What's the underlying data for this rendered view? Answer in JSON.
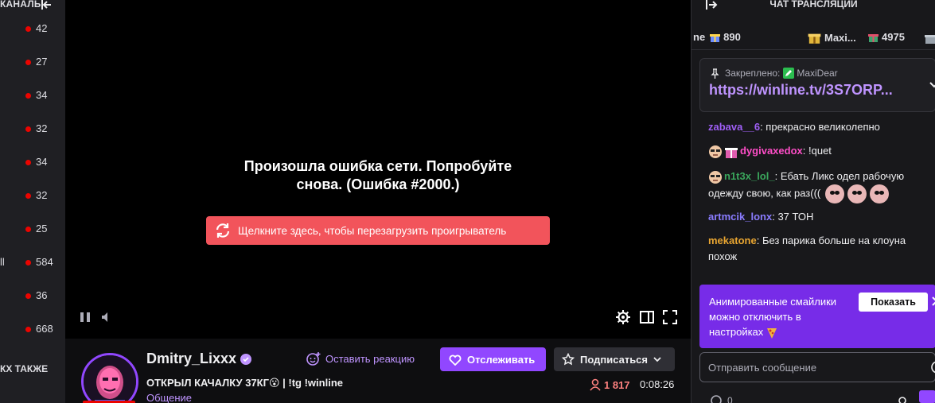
{
  "sidebar": {
    "title": "КАНАЛЫ",
    "collapse_icon": "arrow-collapse-left-icon",
    "channels": [
      {
        "name": "",
        "viewers": "42"
      },
      {
        "name": "",
        "viewers": "27"
      },
      {
        "name": "",
        "viewers": "34"
      },
      {
        "name": "",
        "viewers": "32"
      },
      {
        "name": "",
        "viewers": "34"
      },
      {
        "name": "",
        "viewers": "32"
      },
      {
        "name": "",
        "viewers": "25"
      },
      {
        "name": "ll",
        "viewers": "584"
      },
      {
        "name": "",
        "viewers": "36"
      },
      {
        "name": "",
        "viewers": "668"
      }
    ],
    "also_label": "КХ ТАКЖЕ",
    "live_color": "#eb0400"
  },
  "player": {
    "error_line1": "Произошла ошибка сети. Попробуйте",
    "error_line2": "снова. (Ошибка #2000.)",
    "reload_label": "Щелкните здесь, чтобы перезагрузить проигрыватель",
    "reload_color": "#f2545b"
  },
  "stream": {
    "streamer": "Dmitry_Lixxx",
    "title": "ОТКРЫЛ КАЧАЛКУ 37КГ😮 | !tg !winline",
    "category": "Общение",
    "react_label": "Оставить реакцию",
    "follow_label": "Отслеживать",
    "subscribe_label": "Подписаться",
    "viewers": "1 817",
    "uptime": "0:08:26",
    "accent": "#9147ff"
  },
  "chat": {
    "title": "ЧАТ ТРАНСЛЯЦИИ",
    "gifts": [
      {
        "name": "ne",
        "count": "890"
      },
      {
        "name": "Maxi...",
        "count": ""
      },
      {
        "name": "",
        "count": "4975"
      }
    ],
    "pinned": {
      "label": "Закреплено:",
      "user": "MaxiDear",
      "link": "https://winline.tv/3S7ORP..."
    },
    "messages": [
      {
        "user": "zabava__6",
        "color": "#9f5ff5",
        "text": "прекрасно великолепно"
      },
      {
        "user": "dygivaxedox",
        "color": "#ff4ec8",
        "text": "!quet"
      },
      {
        "user": "n1t3x_lol_",
        "color": "#3aa65c",
        "text": "Ебать Ликс одел рабочую одежду свою, как раз((("
      },
      {
        "user": "artmcik_lonx",
        "color": "#8a7cff",
        "text": "37 ТОН"
      },
      {
        "user": "mekatone",
        "color": "#e8a531",
        "text": "Без парика больше на клоуна похож"
      }
    ],
    "promo": {
      "text": "Анимированные смайлики можно отключить в настройках",
      "button": "Показать"
    },
    "input_placeholder": "Отправить сообщение",
    "points": "0"
  }
}
